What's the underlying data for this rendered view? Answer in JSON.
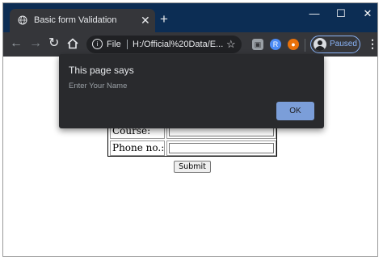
{
  "browser": {
    "tab_title": "Basic form Validation",
    "tab_close": "✕",
    "new_tab": "+",
    "window_controls": {
      "minimize": "—",
      "maximize": "☐",
      "close": "✕"
    },
    "omnibox": {
      "info_icon": "i",
      "scheme_label": "File",
      "url": "H:/Official%20Data/E..."
    },
    "profile_status": "Paused"
  },
  "page": {
    "rows": [
      {
        "label": "Course:"
      },
      {
        "label": "Phone no.:"
      }
    ],
    "submit_label": "Submit"
  },
  "dialog": {
    "title": "This page says",
    "message": "Enter Your Name",
    "ok_label": "OK"
  },
  "colors": {
    "tabstrip": "#0c2d54",
    "toolbar": "#35363a",
    "dialog_bg": "#292a2d",
    "ok_button": "#7b9ed9",
    "profile_accent": "#8ab4f8"
  }
}
